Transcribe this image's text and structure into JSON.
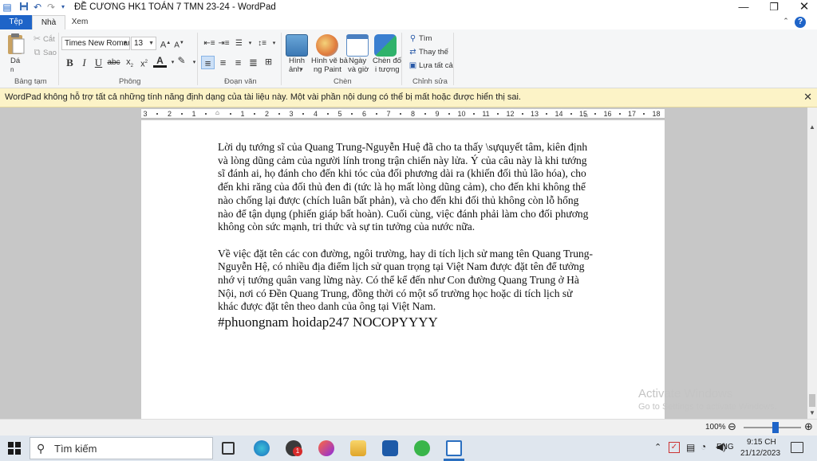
{
  "window": {
    "title": "ĐỀ CƯƠNG HK1 TOÁN 7 TMN 23-24 - WordPad"
  },
  "tabs": [
    "Tệp",
    "Nhà",
    "Xem"
  ],
  "ribbon": {
    "clipboard": {
      "paste": "Dá",
      "paste_sub": "n",
      "cut": "Cắt",
      "copy": "Sao",
      "label": "Bảng tạm"
    },
    "font": {
      "name": "Times New Roman",
      "size": "13",
      "label": "Phông"
    },
    "paragraph": {
      "label": "Đoạn văn"
    },
    "insert": {
      "picture_1": "Hình",
      "picture_2": "ảnh",
      "paint_1": "Hình vẽ bả",
      "paint_2": "ng Paint",
      "date_1": "Ngày",
      "date_2": "và giờ",
      "object_1": "Chèn đố",
      "object_2": "i tượng",
      "label": "Chèn"
    },
    "editing": {
      "find": "Tìm",
      "replace": "Thay thế",
      "select_all": "Lựa tất cả",
      "label": "Chỉnh sửa"
    }
  },
  "infobar": {
    "message": "WordPad không hỗ trợ tất cả những tính năng định dạng của tài liệu này. Một vài phần nội dung có thể bị mất hoặc được hiển thị sai."
  },
  "ruler": {
    "ticks": [
      "3",
      "2",
      "1",
      "",
      "1",
      "2",
      "3",
      "4",
      "5",
      "6",
      "7",
      "8",
      "9",
      "10",
      "11",
      "12",
      "13",
      "14",
      "15",
      "16",
      "17",
      "18"
    ]
  },
  "document": {
    "para1": "Lời dụ tướng sĩ của Quang Trung-Nguyễn Huệ đã cho ta thấy \\sựquyết tâm, kiên định và lòng dũng cảm của người lính trong trận chiến này lửa. Ý của câu này là khi tướng sĩ đánh ai, họ đánh cho đến khi tóc của đối phương dài ra (khiến đối thủ lão hóa), cho đến khi răng của đối thủ đen đi (tức là họ mất lòng dũng cảm), cho đến khi không thể nào chống lại được (chích luân bất phản), và cho đến khi đối thủ không còn lỗ hổng nào để tận dụng (phiến giáp bất hoàn). Cuối cùng, việc đánh phải làm cho đối phương không còn sức mạnh, tri thức và sự tin tưởng của nước nữa.",
    "para2": "Về việc đặt tên các con đường, ngôi trường, hay di tích lịch sử mang tên Quang Trung-Nguyễn Hệ, có nhiều địa điểm lịch sử quan trọng tại Việt Nam được đặt tên để tưởng nhớ vị tướng quân vang lừng này. Có thể kể đến như Con đường Quang Trung ở Hà Nội, nơi có Đền Quang Trung, đồng thời có một số trường học hoặc di tích lịch sử khác được đặt tên theo danh của ông tại Việt Nam.",
    "tag": "#phuongnam hoidap247 NOCOPYYYY"
  },
  "watermark": {
    "line1": "Activate Windows",
    "line2": "Go to Settings to activate Windows."
  },
  "statusbar": {
    "zoom": "100%",
    "zoom_fraction": 0.5
  },
  "taskbar": {
    "search_placeholder": "Tìm kiếm",
    "badge": "1",
    "lang": "ENG",
    "time": "9:15 CH",
    "date": "21/12/2023"
  }
}
